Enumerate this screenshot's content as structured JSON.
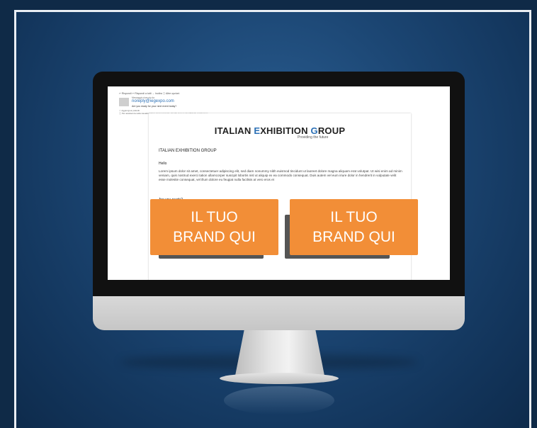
{
  "client": {
    "toolbar": "↩ Rispondi  ↩ Rispondi a tutti  → Inoltra  ⓘ Altre opzioni",
    "from_label": "Messaggio ricevuto da",
    "from_address": "noreply@iegexpo.com",
    "subject": "Are you ready for your next event today?",
    "meta_line1": "☆ Aggiungi ai preferiti",
    "meta_line2": "ⓘ Per assistenza nella visualizzazione del messaggio, fai clic qui per visualizzarlo nel browser."
  },
  "email": {
    "logo_prefix": "ITALIAN ",
    "logo_e": "E",
    "logo_mid": "XHIBITION ",
    "logo_g": "G",
    "logo_end": "ROUP",
    "tagline": "Providing the future",
    "org": "ITALIAN EXHIBITION GROUP",
    "hello": "Hello",
    "lorem": "Lorem ipsum dolor sit amet, consectetuer adipiscing elit, sed diam nonummy nibh euismod tincidunt ut laoreet dolore magna aliquam erat volutpat. Ut wisi enim ad minim veniam, quis nostrud exerci tation ullamcorper suscipit lobortis nisl ut aliquip ex ea commodo consequat. Duis autem vel eum iriure dolor in hendrerit in vulputate velit esse molestie consequat, vel illum dolore eu feugiat nulla facilisis at vero eros et",
    "ready": "Are you ready?"
  },
  "brands": [
    {
      "line1": "IL TUO",
      "line2": "BRAND QUI"
    },
    {
      "line1": "IL TUO",
      "line2": "BRAND QUI"
    }
  ],
  "colors": {
    "brand_orange": "#f28e37",
    "logo_accent": "#2a6fb5"
  }
}
